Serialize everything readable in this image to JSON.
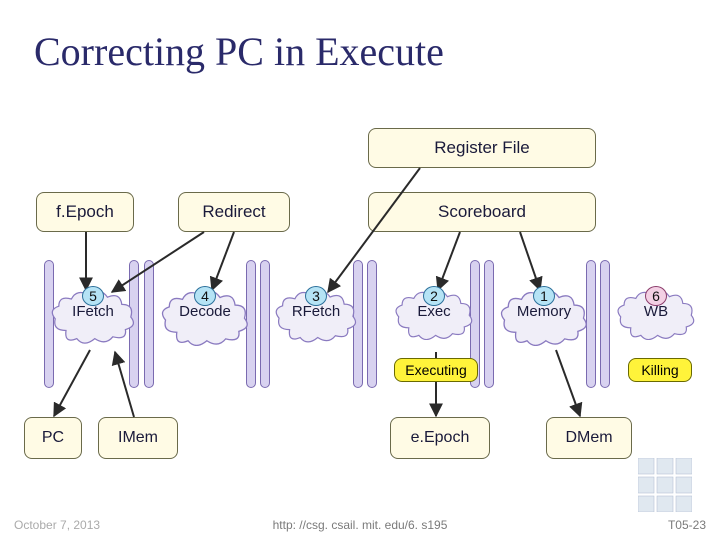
{
  "title": "Correcting PC in Execute",
  "blocks": {
    "register_file": "Register File",
    "fepoch": "f.Epoch",
    "redirect": "Redirect",
    "scoreboard": "Scoreboard",
    "pc": "PC",
    "imem": "IMem",
    "eepoch": "e.Epoch",
    "dmem": "DMem"
  },
  "stages": [
    {
      "num": "5",
      "label": "IFetch",
      "color": "blue"
    },
    {
      "num": "4",
      "label": "Decode",
      "color": "blue"
    },
    {
      "num": "3",
      "label": "RFetch",
      "color": "blue"
    },
    {
      "num": "2",
      "label": "Exec",
      "color": "blue"
    },
    {
      "num": "1",
      "label": "Memory",
      "color": "blue"
    },
    {
      "num": "6",
      "label": "WB",
      "color": "pink"
    }
  ],
  "pills": {
    "executing": "Executing",
    "killing": "Killing"
  },
  "footer": {
    "date": "October 7, 2013",
    "url": "http: //csg. csail. mit. edu/6. s195",
    "slide": "T05-23"
  }
}
